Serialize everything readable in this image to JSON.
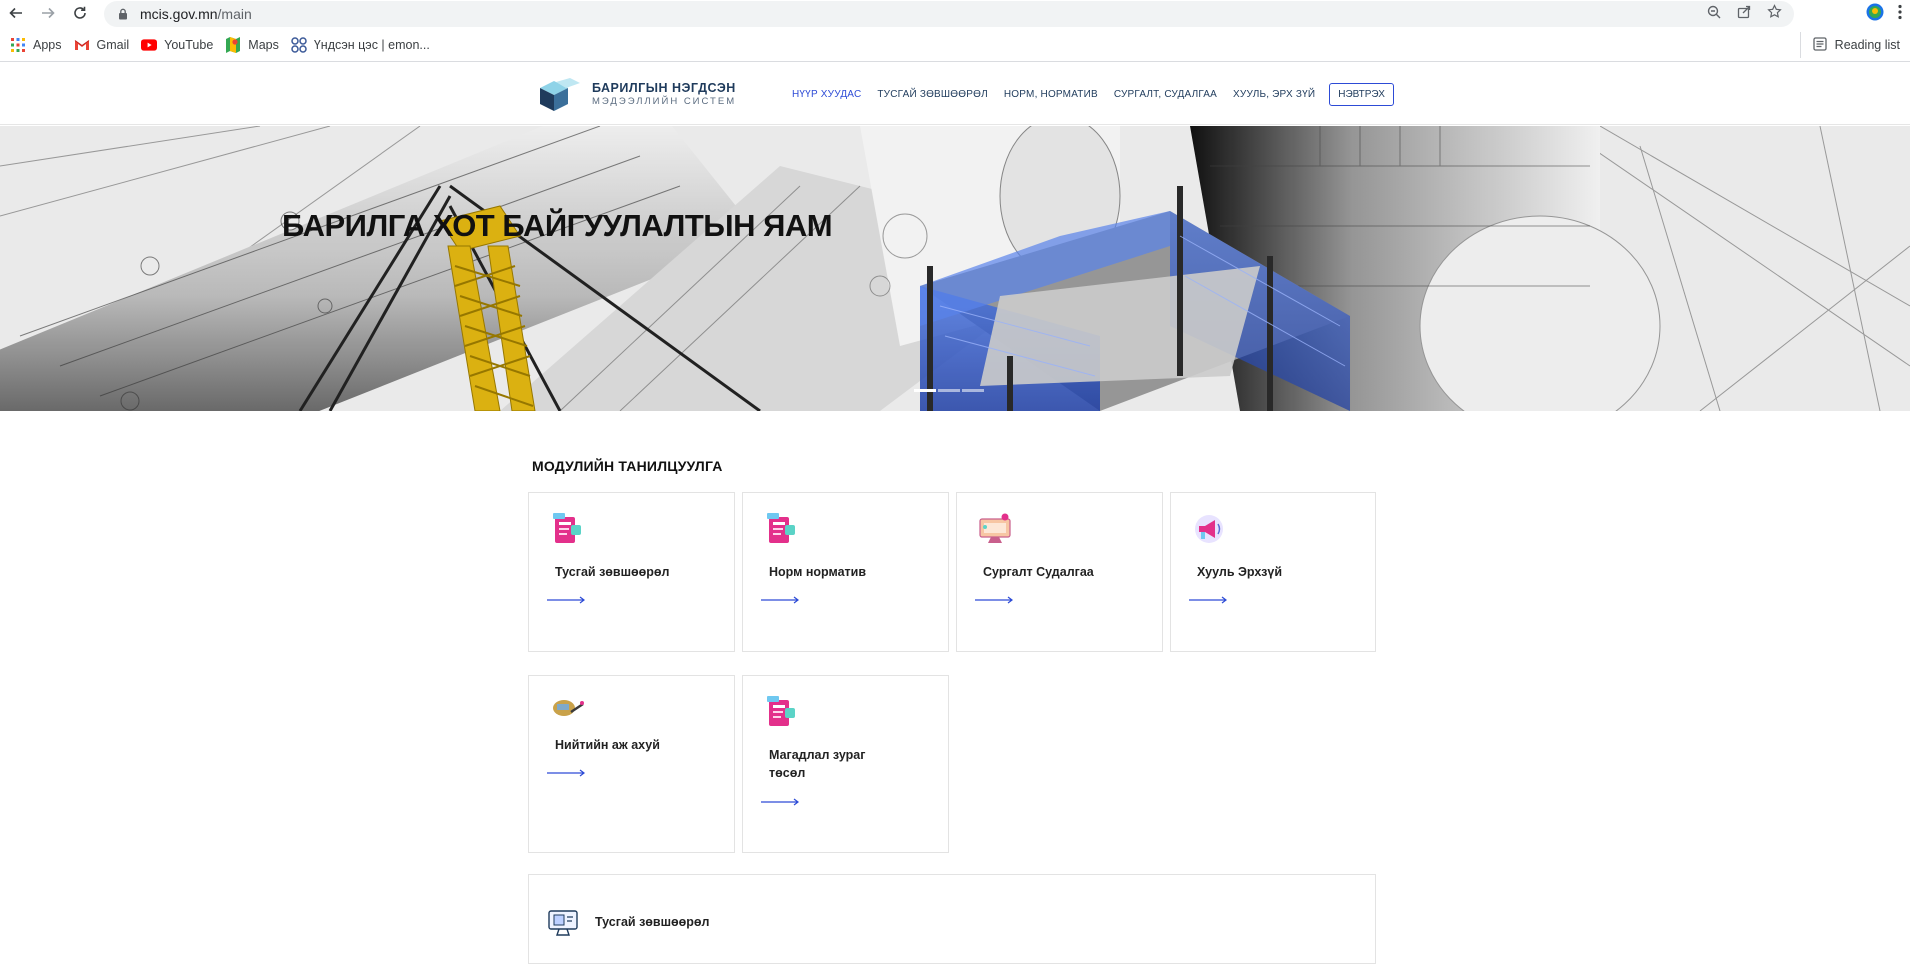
{
  "browser": {
    "url_host": "mcis.gov.mn",
    "url_path": "/main",
    "bookmarks": [
      {
        "label": "Apps",
        "icon": "apps-grid-icon"
      },
      {
        "label": "Gmail",
        "icon": "gmail-icon"
      },
      {
        "label": "YouTube",
        "icon": "youtube-icon"
      },
      {
        "label": "Maps",
        "icon": "maps-icon"
      },
      {
        "label": "Үндсэн цэс | emon...",
        "icon": "emon-icon"
      }
    ],
    "reading_list": "Reading list"
  },
  "site": {
    "logo_line1": "БАРИЛГЫН НЭГДСЭН",
    "logo_line2": "МЭДЭЭЛЛИЙН СИСТЕМ",
    "nav": [
      {
        "label": "НҮҮР ХУУДАС",
        "active": true
      },
      {
        "label": "ТУСГАЙ ЗӨВШӨӨРӨЛ",
        "active": false
      },
      {
        "label": "НОРМ, НОРМАТИВ",
        "active": false
      },
      {
        "label": "СУРГАЛТ, СУДАЛГАА",
        "active": false
      },
      {
        "label": "ХУУЛЬ, ЭРХ ЗҮЙ",
        "active": false
      }
    ],
    "login": "НЭВТРЭХ"
  },
  "hero": {
    "title": "БАРИЛГА ХОТ БАЙГУУЛАЛТЫН ЯАМ",
    "slides": 3,
    "active_slide": 1
  },
  "modules": {
    "title": "МОДУЛИЙН ТАНИЛЦУУЛГА",
    "cards": [
      {
        "label": "Тусгай зөвшөөрөл",
        "icon": "permit-document-icon"
      },
      {
        "label": "Норм норматив",
        "icon": "norm-document-icon"
      },
      {
        "label": "Сургалт Судалгаа",
        "icon": "training-monitor-icon"
      },
      {
        "label": "Хууль Эрхзүй",
        "icon": "law-megaphone-icon"
      },
      {
        "label": "Нийтийн аж ахуй",
        "icon": "public-utility-icon"
      },
      {
        "label_line1": "Магадлал зураг",
        "label_line2": "төсөл",
        "icon": "expertise-document-icon"
      }
    ],
    "wide_card": {
      "label": "Тусгай зөвшөөрөл",
      "icon": "permit-monitor-icon"
    }
  },
  "colors": {
    "accent": "#2d4bd6",
    "navy": "#1f3b5c"
  }
}
